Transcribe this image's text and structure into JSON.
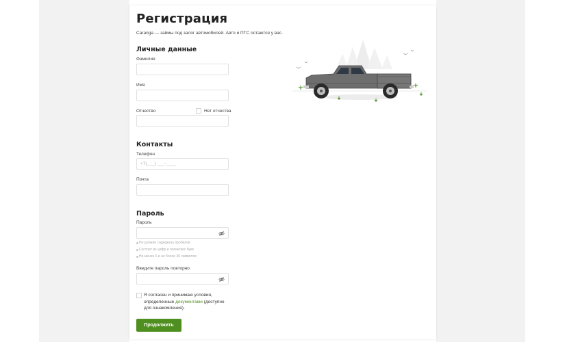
{
  "form": {
    "title": "Регистрация",
    "subtitle": "Caranga — займы под залог автомобилей. Авто и ПТС остаются у вас.",
    "personal": {
      "heading": "Личные данные",
      "surname_label": "Фамилия",
      "name_label": "Имя",
      "patronymic_label": "Отчество",
      "no_patronymic_label": "Нет отчества"
    },
    "contacts": {
      "heading": "Контакты",
      "phone_label": "Телефон",
      "phone_placeholder": "+7(___) ___-____",
      "email_label": "Почта"
    },
    "password": {
      "heading": "Пароль",
      "password_label": "Пароль",
      "hints": [
        "Не должен содержать пробелов",
        "Состоит из цифр и латинских букв",
        "Не менее 6 и не более 30 символов"
      ],
      "repeat_label": "Введите пароль повторно"
    },
    "agree": {
      "text_before": "Я согласен и принимаю условия, определенные ",
      "link": "документами",
      "text_after": " (доступно для ознакомления)."
    },
    "submit_label": "Продолжить"
  },
  "colors": {
    "accent": "#4f8f1f",
    "page_side": "#f2f2f2"
  },
  "icons": {
    "eye": "eye-off-icon",
    "illustration": "pickup-truck-illustration"
  }
}
